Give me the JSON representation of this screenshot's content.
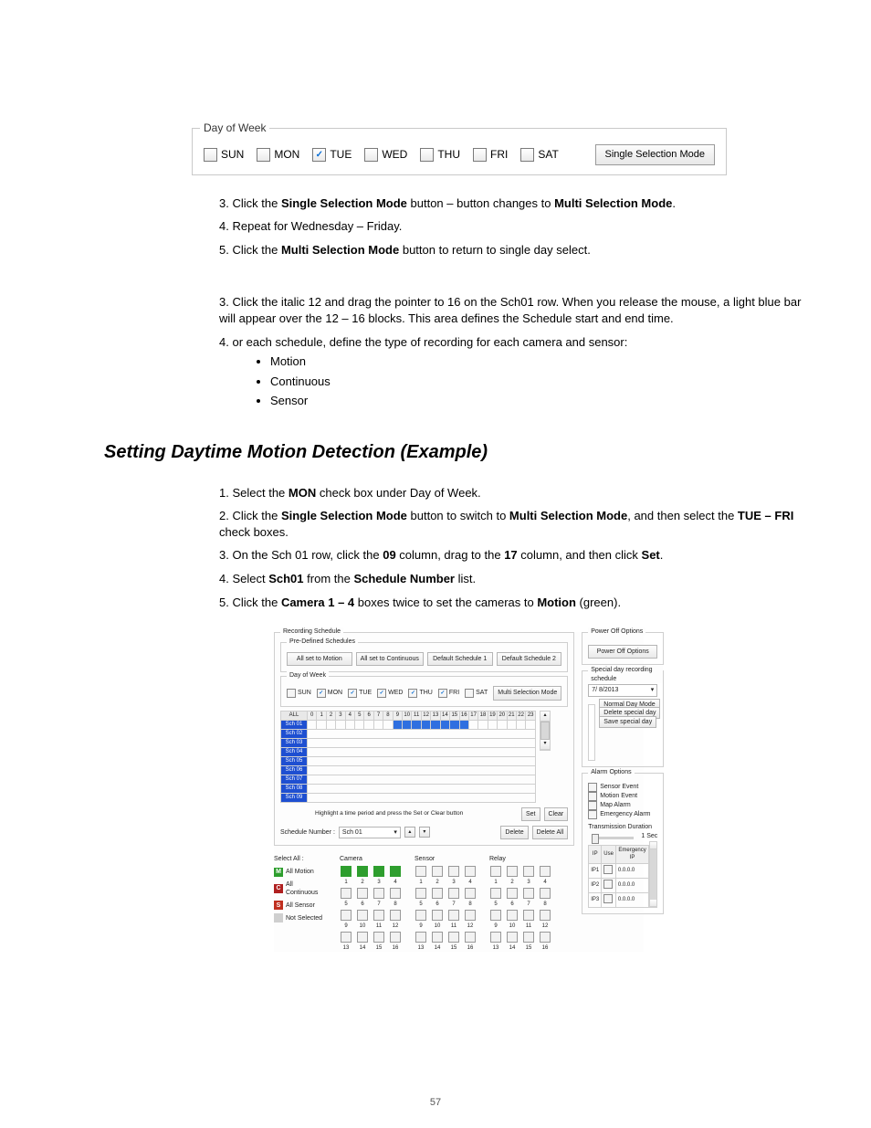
{
  "daygroup": {
    "legend": "Day of Week",
    "days": [
      {
        "label": "SUN",
        "checked": false
      },
      {
        "label": "MON",
        "checked": false
      },
      {
        "label": "TUE",
        "checked": true
      },
      {
        "label": "WED",
        "checked": false
      },
      {
        "label": "THU",
        "checked": false
      },
      {
        "label": "FRI",
        "checked": false
      },
      {
        "label": "SAT",
        "checked": false
      }
    ],
    "mode_button": "Single Selection Mode"
  },
  "steps1": {
    "s3": {
      "num": "3.",
      "prefix": "Click the ",
      "bold1": "Single Selection Mode",
      "mid": " button – button changes to ",
      "bold2": "Multi Selection Mode",
      "suffix": "."
    },
    "s4": {
      "num": "4.",
      "prefix": "Repeat for Wednesday – Friday."
    },
    "s5": {
      "num": "5.",
      "prefix": "Click the ",
      "bold": "Multi Selection Mode",
      "suffix": " button to return to single day select."
    }
  },
  "steps2": {
    "s3": {
      "num": "3.",
      "text": "Click the italic 12 and drag the pointer to 16 on the Sch01 row. When you release the mouse, a light blue bar will appear over the 12 – 16 blocks. This area defines the Schedule start and end time."
    },
    "s4": {
      "num": "4.",
      "text": "or each schedule, define the type of recording for each camera and sensor:",
      "bullets": [
        "Motion",
        "Continuous",
        "Sensor"
      ]
    }
  },
  "example_heading": "Setting Daytime Motion Detection (Example)",
  "steps3": {
    "s1": {
      "num": "1.",
      "prefix": "Select the ",
      "bold": "MON",
      "suffix": " check box under Day of Week."
    },
    "s2": {
      "num": "2.",
      "prefix": "Click the ",
      "bold1": "Single Selection Mode",
      "mid": " button to switch to ",
      "bold2": "Multi Selection Mode",
      "post": ", and then select the ",
      "bold3": "TUE – FRI",
      "suffix": " check boxes."
    },
    "s3": {
      "num": "3.",
      "prefix": "On the Sch 01 row, click the ",
      "bold1": "09",
      "mid": " column, drag to the ",
      "bold2": "17",
      "post": " column, and then click ",
      "bold3": "Set",
      "suffix": "."
    },
    "s4": {
      "num": "4.",
      "prefix": "Select ",
      "bold1": "Sch01",
      "mid": " from the ",
      "bold2": "Schedule Number",
      "post": " list."
    },
    "s5": {
      "num": "5.",
      "prefix": "Click the ",
      "bold1": "Camera 1 – 4",
      "mid": " boxes twice to set the cameras to ",
      "bold2": "Motion",
      "post": " (green)."
    }
  },
  "panel": {
    "recsched": "Recording Schedule",
    "predef": "Pre-Defined Schedules",
    "predef_buttons": [
      "All set to Motion",
      "All set to Continuous",
      "Default Schedule 1",
      "Default Schedule 2"
    ],
    "poweroff": {
      "legend": "Power Off Options",
      "button": "Power Off Options"
    },
    "dow_legend": "Day of Week",
    "dow": [
      {
        "label": "SUN",
        "checked": false
      },
      {
        "label": "MON",
        "checked": true
      },
      {
        "label": "TUE",
        "checked": true
      },
      {
        "label": "WED",
        "checked": true
      },
      {
        "label": "THU",
        "checked": true
      },
      {
        "label": "FRI",
        "checked": true
      },
      {
        "label": "SAT",
        "checked": false
      }
    ],
    "dow_button": "Multi Selection Mode",
    "hours": [
      "0",
      "1",
      "2",
      "3",
      "4",
      "5",
      "6",
      "7",
      "8",
      "9",
      "10",
      "11",
      "12",
      "13",
      "14",
      "15",
      "16",
      "17",
      "18",
      "19",
      "20",
      "21",
      "22",
      "23"
    ],
    "all": "ALL",
    "sch_labels": [
      "Sch 01",
      "Sch 02",
      "Sch 03",
      "Sch 04",
      "Sch 05",
      "Sch 06",
      "Sch 07",
      "Sch 08",
      "Sch 09"
    ],
    "highlight_note": "Highlight a time period and press the Set or Clear button",
    "set": "Set",
    "clear": "Clear",
    "sched_num_label": "Schedule Number :",
    "sched_num_value": "Sch 01",
    "delete": "Delete",
    "delete_all": "Delete All",
    "selectall": "Select All :",
    "sa_items": [
      {
        "badge": "M",
        "label": "All Motion",
        "cls": "m"
      },
      {
        "badge": "C",
        "label": "All Continuous",
        "cls": "c"
      },
      {
        "badge": "S",
        "label": "All Sensor",
        "cls": "s"
      },
      {
        "badge": "",
        "label": "Not Selected",
        "cls": "n"
      }
    ],
    "grid_headers": [
      "Camera",
      "Sensor",
      "Relay"
    ],
    "grid_nums": [
      1,
      2,
      3,
      4,
      5,
      6,
      7,
      8,
      9,
      10,
      11,
      12,
      13,
      14,
      15,
      16
    ],
    "special": {
      "legend": "Special day recording schedule",
      "date": "7/ 8/2013",
      "normal": "Normal Day Mode",
      "delete": "Delete special day",
      "save": "Save special day"
    },
    "alarm": {
      "legend": "Alarm Options",
      "items": [
        "Sensor Event",
        "Motion Event",
        "Map Alarm",
        "Emergency Alarm"
      ],
      "trans": "Transmission Duration",
      "dur": "1 Sec",
      "ip_headers": [
        "IP",
        "Use",
        "Emergency IP"
      ],
      "ip_rows": [
        {
          "n": "IP1",
          "ip": "0.0.0.0"
        },
        {
          "n": "IP2",
          "ip": "0.0.0.0"
        },
        {
          "n": "IP3",
          "ip": "0.0.0.0"
        }
      ]
    }
  },
  "page_number": "57"
}
